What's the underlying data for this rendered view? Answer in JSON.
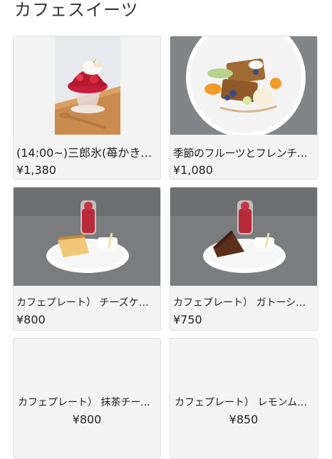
{
  "section": {
    "title": "カフェスイーツ"
  },
  "items": [
    {
      "name": "(14:00~)三郎氷(苺かき…",
      "price": "¥1,380",
      "image": "shaved-ice-strawberry-photo"
    },
    {
      "name": "季節のフルーツとフレンチトースト",
      "price": "¥1,080",
      "image": "french-toast-fruit-photo"
    },
    {
      "name": "カフェプレート） チーズケーキ",
      "price": "¥800",
      "image": "cheesecake-plate-photo"
    },
    {
      "name": "カフェプレート） ガトーショコラ",
      "price": "¥750",
      "image": "gateau-chocolat-plate-photo"
    },
    {
      "name": "カフェプレート） 抹茶チーズケーキ",
      "price": "¥800",
      "image": ""
    },
    {
      "name": "カフェプレート） レモンムー…",
      "price": "¥850",
      "image": ""
    }
  ],
  "colors": {
    "card_bg": "#f4f4f4",
    "card_border": "#e0e0e0",
    "text": "#222222"
  }
}
